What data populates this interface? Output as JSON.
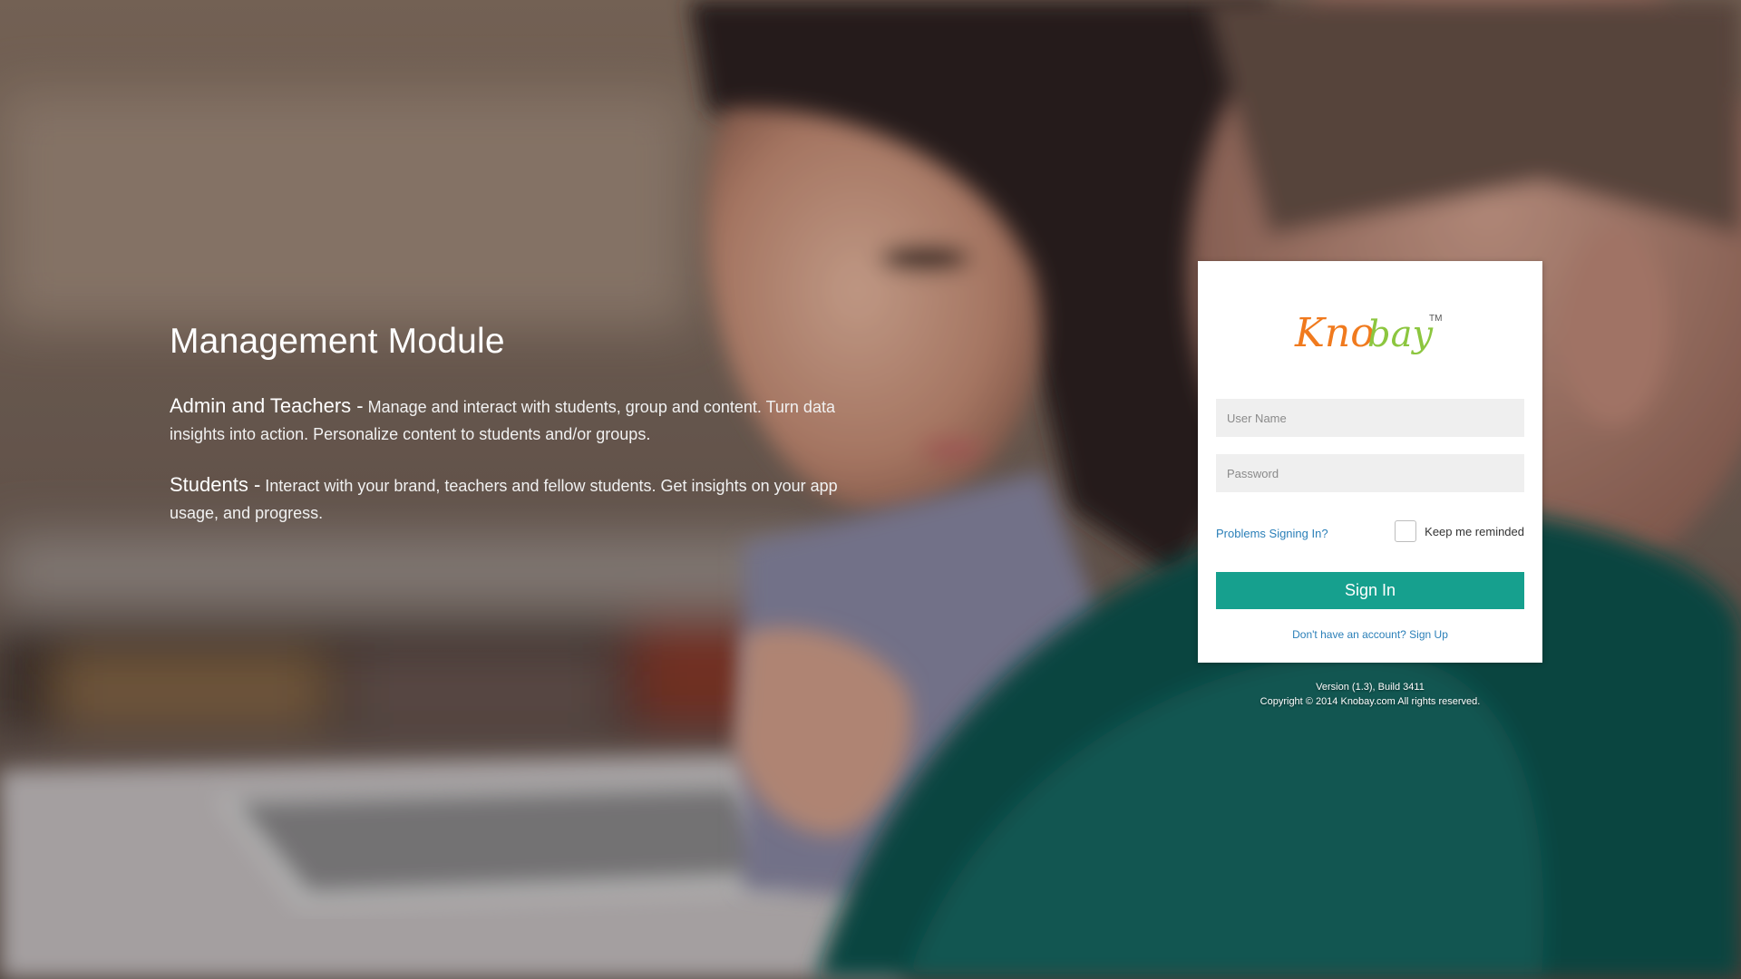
{
  "intro": {
    "title": "Management Module",
    "admin_lead": "Admin and Teachers -",
    "admin_text": "Manage and interact with students, group and content. Turn data insights into action. Personalize content to students and/or groups.",
    "students_lead": "Students -",
    "students_text": "Interact with your brand, teachers and fellow students. Get insights on your app usage, and progress."
  },
  "login": {
    "logo_text_part1": "Kno",
    "logo_text_part2": "bay",
    "logo_tm": "TM",
    "username_placeholder": "User Name",
    "password_placeholder": "Password",
    "problems_link": "Problems Signing In?",
    "keep_label": "Keep me reminded",
    "keep_checked": false,
    "signin_label": "Sign In",
    "signup_text": "Don't have an account? Sign Up"
  },
  "footer": {
    "version": "Version (1.3), Build 3411",
    "copyright": "Copyright © 2014 Knobay.com All rights reserved."
  },
  "colors": {
    "accent": "#16a08e",
    "link": "#2a7fb8",
    "logo_orange": "#f07a1e",
    "logo_green": "#8cc63f"
  }
}
